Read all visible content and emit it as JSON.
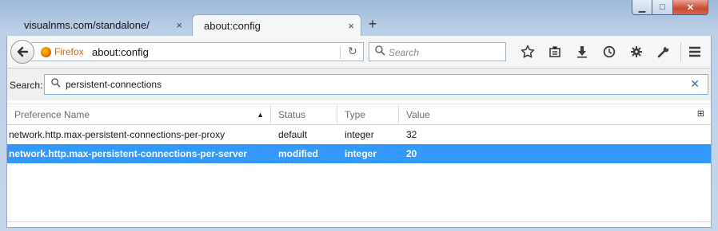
{
  "window": {
    "minimize_glyph": "▁",
    "maximize_glyph": "□",
    "close_glyph": "✕"
  },
  "tabs": [
    {
      "label": "visualnms.com/standalone/",
      "close": "×"
    },
    {
      "label": "about:config",
      "close": "×"
    }
  ],
  "newtab_glyph": "+",
  "navbar": {
    "identity": "Firefox",
    "url": "about:config",
    "reload_glyph": "↻",
    "search_placeholder": "Search",
    "icons": [
      "star-icon",
      "reading-list-icon",
      "download-icon",
      "history-icon",
      "gear-icon",
      "wrench-icon",
      "menu-icon"
    ]
  },
  "about_config": {
    "search_label": "Search:",
    "search_value": "persistent-connections",
    "clear_glyph": "✕",
    "columns": [
      "Preference Name",
      "Status",
      "Type",
      "Value"
    ],
    "sort_glyph": "▲",
    "column_picker_glyph": "⊞",
    "rows": [
      {
        "name": "network.http.max-persistent-connections-per-proxy",
        "status": "default",
        "type": "integer",
        "value": "32",
        "selected": false
      },
      {
        "name": "network.http.max-persistent-connections-per-server",
        "status": "modified",
        "type": "integer",
        "value": "20",
        "selected": true
      }
    ]
  },
  "colors": {
    "selection": "#3399ff",
    "firefox_orange": "#e66000",
    "filter_border": "#7eb4ea"
  }
}
